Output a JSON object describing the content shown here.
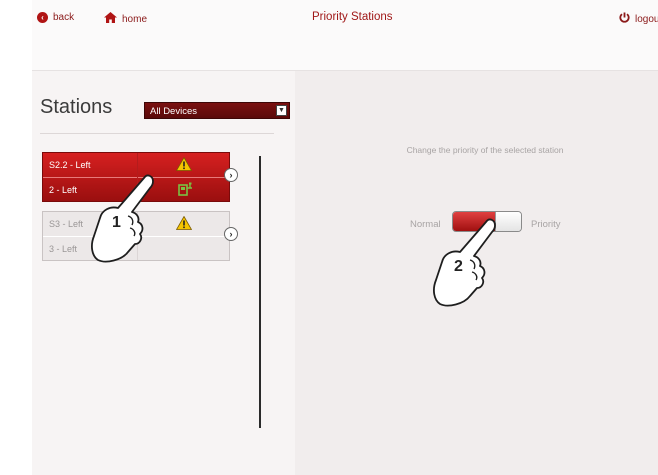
{
  "header": {
    "back_label": "back",
    "home_label": "home",
    "title": "Priority Stations",
    "logout_label": "logou"
  },
  "stations": {
    "title": "Stations",
    "filter_selected": "All Devices",
    "items": [
      {
        "name": "S2.2 - Left",
        "sub": "2 - Left",
        "selected": true,
        "icons": [
          "warning-icon",
          "plug-icon"
        ]
      },
      {
        "name": "S3 - Left",
        "sub": "3 - Left",
        "selected": false,
        "icons": [
          "warning-icon"
        ]
      }
    ]
  },
  "priority": {
    "instruction": "Change the priority of the selected station",
    "left_label": "Normal",
    "right_label": "Priority"
  },
  "annotations": {
    "step1": "1",
    "step2": "2"
  },
  "colors": {
    "accent": "#b01414",
    "selected_card": "#c41a1a",
    "text_muted": "#a8a4a4"
  }
}
